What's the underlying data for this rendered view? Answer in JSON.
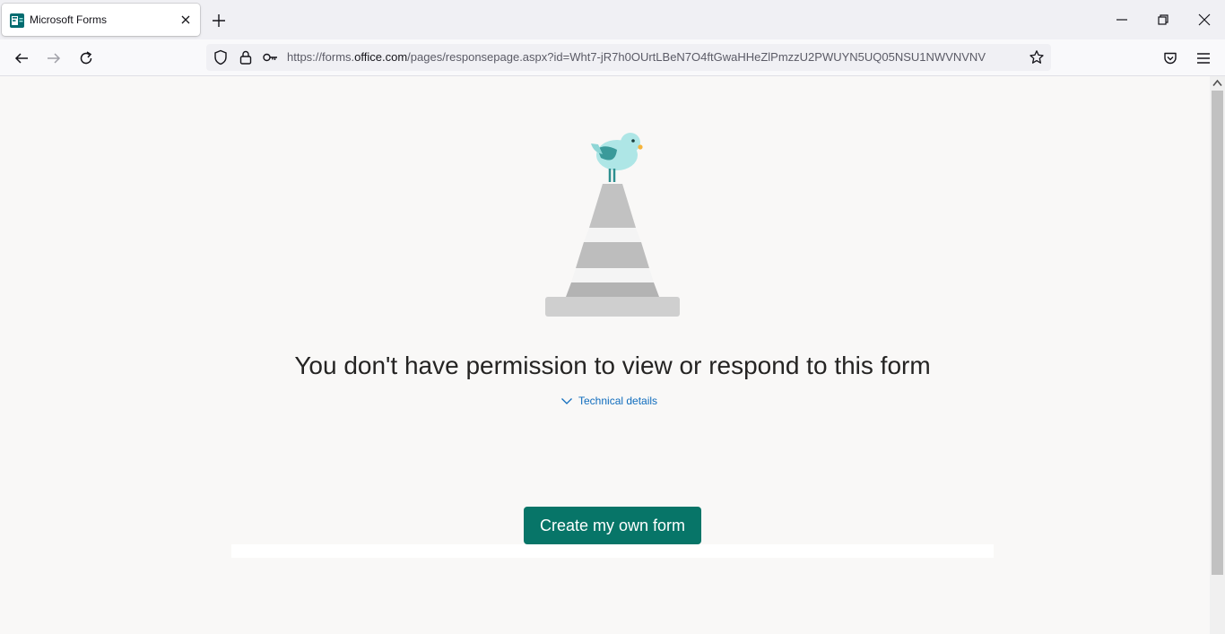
{
  "browser": {
    "tab": {
      "title": "Microsoft Forms",
      "favicon": "forms-icon"
    },
    "url": {
      "prefix": "https://forms.",
      "host": "office.com",
      "path": "/pages/responsepage.aspx?id=Wht7-jR7h0OUrtLBeN7O4ftGwaHHeZlPmzzU2PWUYN5UQ05NSU1NWVNVNV"
    }
  },
  "page": {
    "message": "You don't have permission to view or respond to this form",
    "technical_details_label": "Technical details",
    "create_button_label": "Create my own form"
  },
  "colors": {
    "accent": "#077568",
    "link": "#0f6cbd",
    "background": "#f9f8f7"
  }
}
